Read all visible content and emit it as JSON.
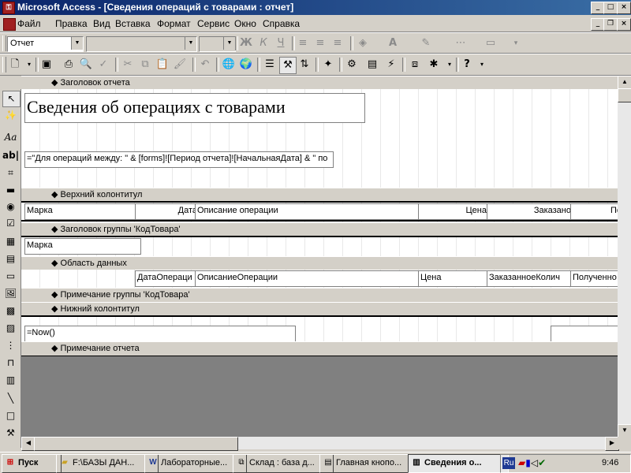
{
  "window": {
    "title": "Microsoft Access - [Сведения операций с товарами : отчет]",
    "app_icon": "access-key-icon"
  },
  "menu": {
    "items": [
      "Файл",
      "Правка",
      "Вид",
      "Вставка",
      "Формат",
      "Сервис",
      "Окно",
      "Справка"
    ]
  },
  "format_toolbar": {
    "object_combo": "Отчет",
    "font_combo": "",
    "size_combo": "",
    "bold": "Ж",
    "italic": "К",
    "underline": "Ч"
  },
  "report": {
    "sections": {
      "report_header": "Заголовок отчета",
      "page_header": "Верхний колонтитул",
      "group_header": "Заголовок группы 'КодТовара'",
      "detail": "Область данных",
      "group_footer": "Примечание группы 'КодТовара'",
      "page_footer": "Нижний колонтитул",
      "report_footer": "Примечание отчета"
    },
    "title_label": "Сведения об операциях с товарами",
    "period_expr": "=\"Для операций между: \" & [forms]![Период отчета]![НачальнаяДата] & \" по",
    "page_header_labels": [
      "Марка",
      "Дата",
      "Описание операции",
      "Цена",
      "Заказано",
      "По"
    ],
    "group_field": "Марка",
    "detail_fields": [
      "ДатаОпераци",
      "ОписаниеОперации",
      "Цена",
      "ЗаказанноеКолич",
      "Полученно"
    ],
    "footer_expr": "=Now()"
  },
  "taskbar": {
    "start": "Пуск",
    "tasks": [
      {
        "label": "F:\\БАЗЫ ДАН...",
        "icon": "folder-icon"
      },
      {
        "label": "Лабораторные...",
        "icon": "word-icon"
      },
      {
        "label": "Склад : база д...",
        "icon": "database-window-icon"
      },
      {
        "label": "Главная кнопо...",
        "icon": "form-icon"
      },
      {
        "label": "Сведения о...",
        "icon": "report-icon",
        "active": true
      }
    ],
    "lang": "Ru",
    "clock": "9:46"
  }
}
